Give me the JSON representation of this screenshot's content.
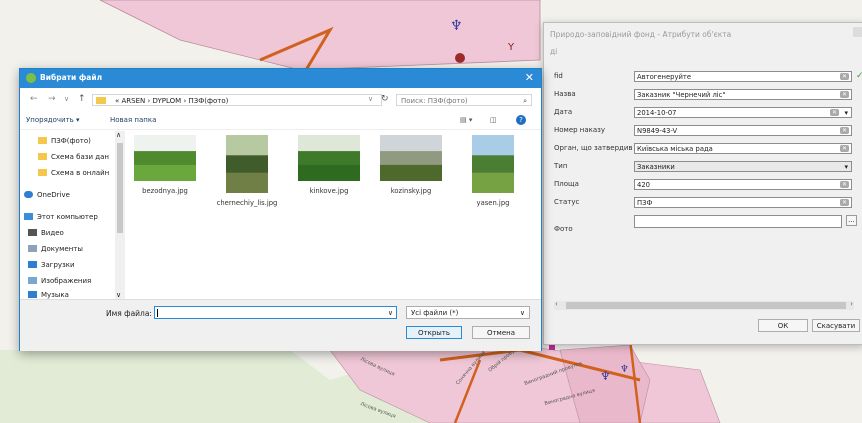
{
  "attr_form": {
    "title": "Природо-заповідний фонд - Атрибути об'єкта",
    "subtitle": "ді",
    "fields": [
      {
        "label": "fid",
        "value": "Автогенеруйте"
      },
      {
        "label": "Назва",
        "value": "Заказник \"Чернечий ліс\""
      },
      {
        "label": "Дата",
        "value": "2014-10-07"
      },
      {
        "label": "Номер наказу",
        "value": "N9849-43-V"
      },
      {
        "label": "Орган, що затвердив",
        "value": "Київська міська рада"
      },
      {
        "label": "Тип",
        "value": "Заказники"
      },
      {
        "label": "Площа",
        "value": "420"
      },
      {
        "label": "Статус",
        "value": "ПЗФ"
      },
      {
        "label": "Фото",
        "value": ""
      }
    ],
    "ok_label": "ОК",
    "cancel_label": "Скасувати",
    "dots_label": "..."
  },
  "dialog": {
    "title": "Вибрати файл",
    "breadcrumb": "« ARSEN › DYPLOM › ПЗФ(фото)",
    "search_placeholder": "Поиск: ПЗФ(фото)",
    "organize_label": "Упорядочить ▾",
    "new_folder_label": "Новая папка",
    "sidebar": [
      {
        "label": "ПЗФ(фото)",
        "icon": "folder-icon"
      },
      {
        "label": "Схема бази дан",
        "icon": "folder-icon"
      },
      {
        "label": "Схема в онлайн",
        "icon": "folder-icon"
      },
      {
        "label": "OneDrive",
        "icon": "cloud-icon"
      },
      {
        "label": "Этот компьютер",
        "icon": "computer-icon"
      },
      {
        "label": "Видео",
        "icon": "video-icon"
      },
      {
        "label": "Документы",
        "icon": "document-icon"
      },
      {
        "label": "Загрузки",
        "icon": "download-icon"
      },
      {
        "label": "Изображения",
        "icon": "image-icon"
      },
      {
        "label": "Музыка",
        "icon": "music-icon"
      }
    ],
    "files": [
      {
        "name": "bezodnya.jpg",
        "sky": "#eef3ef",
        "top": "#4f8a2e",
        "bottom": "#6aa73c"
      },
      {
        "name": "chernechiy_lis.jpg",
        "sky": "#b7c9a1",
        "top": "#3f5c2a",
        "bottom": "#6f7f45"
      },
      {
        "name": "kinkove.jpg",
        "sky": "#dfe7d8",
        "top": "#3f7a2b",
        "bottom": "#2f6a21"
      },
      {
        "name": "kozinsky.jpg",
        "sky": "#cfd5d9",
        "top": "#8f9a80",
        "bottom": "#4d6a2c"
      },
      {
        "name": "yasen.jpg",
        "sky": "#a9cce7",
        "top": "#4b7d33",
        "bottom": "#77a243"
      }
    ],
    "filename_label": "Имя файла:",
    "filename_value": "",
    "filetype_label": "Усі файли (*)",
    "open_label": "Открыть",
    "cancel_label": "Отмена"
  },
  "map": {
    "street_labels": [
      "Лісова вулиця",
      "Сонячна вулиця",
      "Обрій провулок",
      "Виноградний провулок",
      "Виноградна вулиця",
      "Лісова вулиця"
    ]
  },
  "colors": {
    "accent": "#2b8ad6",
    "map_pink": "#f0c7d6",
    "road_orange": "#d1611e"
  }
}
